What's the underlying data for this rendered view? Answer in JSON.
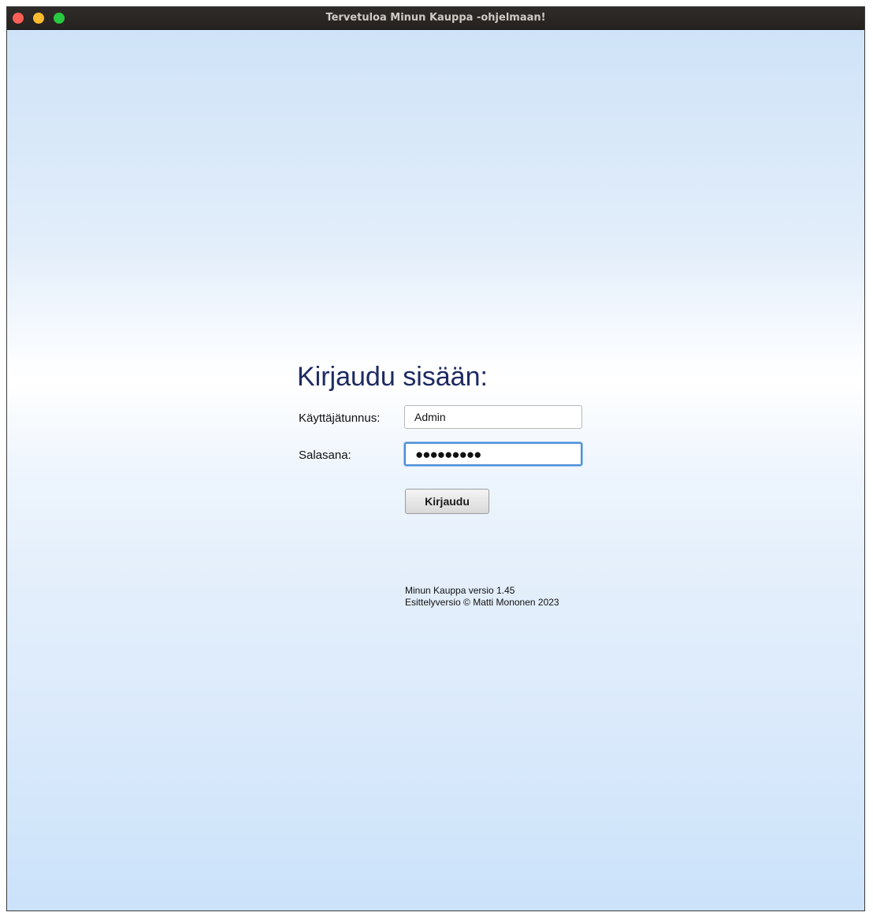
{
  "window": {
    "title": "Tervetuloa Minun Kauppa -ohjelmaan!",
    "controls": [
      "close-icon",
      "minimize-icon",
      "zoom-icon"
    ]
  },
  "login": {
    "heading": "Kirjaudu sisään:",
    "username_label": "Käyttäjätunnus:",
    "username_value": "Admin",
    "password_label": "Salasana:",
    "password_mask": "●●●●●●●●●",
    "submit_label": "Kirjaudu"
  },
  "footer": {
    "version": "Minun Kauppa versio 1.45",
    "copyright": "Esittelyversio © Matti Mononen 2023"
  },
  "colors": {
    "heading": "#1d2a62",
    "focus_ring": "#4b8fd6",
    "close": "#fe5f57",
    "minimize": "#febc2e",
    "zoom": "#28c840"
  }
}
